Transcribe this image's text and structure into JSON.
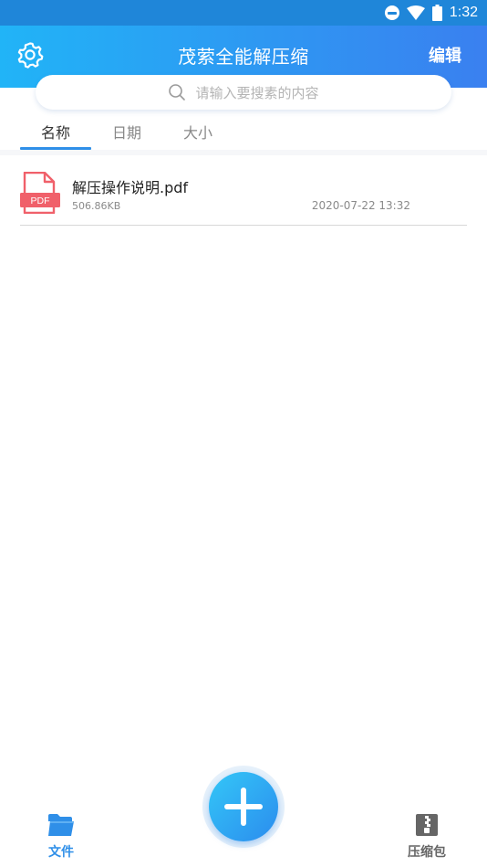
{
  "status_bar": {
    "time": "1:32"
  },
  "app_bar": {
    "title": "茂萦全能解压缩",
    "edit_label": "编辑"
  },
  "search": {
    "placeholder": "请输入要搜素的内容"
  },
  "sort_tabs": [
    {
      "label": "名称",
      "active": true
    },
    {
      "label": "日期",
      "active": false
    },
    {
      "label": "大小",
      "active": false
    }
  ],
  "files": [
    {
      "name": "解压操作说明.pdf",
      "size": "506.86KB",
      "date": "2020-07-22 13:32",
      "icon": "pdf-file-icon",
      "icon_label": "PDF"
    }
  ],
  "bottom_nav": {
    "files_label": "文件",
    "archive_label": "压缩包"
  },
  "colors": {
    "accent": "#2f8fe8",
    "header_start": "#21b4f7",
    "header_end": "#3a80f0",
    "pdf_red": "#f0606a"
  }
}
